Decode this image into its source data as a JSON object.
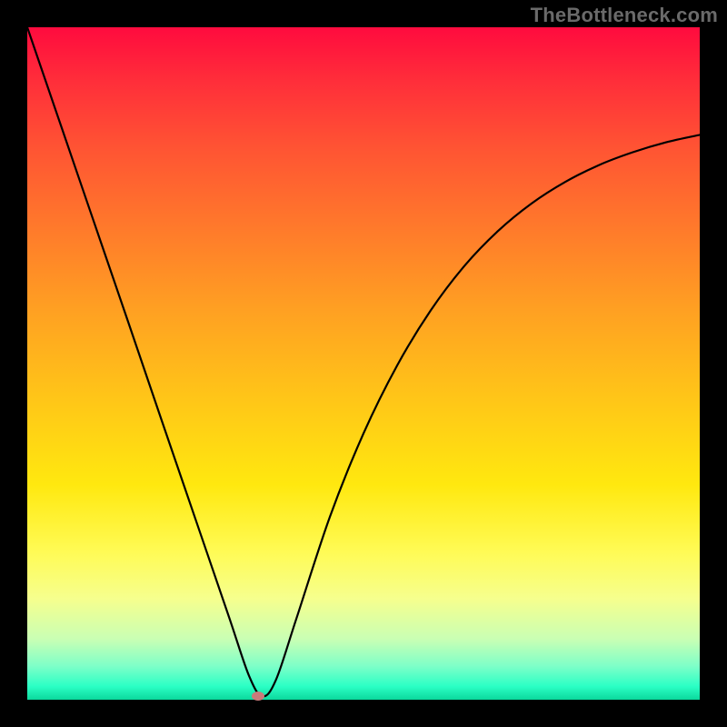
{
  "domain": "Chart",
  "watermark": "TheBottleneck.com",
  "colors": {
    "frame": "#000000",
    "gradient_top": "#ff0b3e",
    "gradient_bottom": "#0bd89c",
    "curve": "#000000",
    "marker": "#c97a7a"
  },
  "chart_data": {
    "type": "line",
    "title": "",
    "xlabel": "",
    "ylabel": "",
    "xlim": [
      0,
      100
    ],
    "ylim": [
      0,
      100
    ],
    "series": [
      {
        "name": "bottleneck-curve",
        "x": [
          0,
          5,
          10,
          15,
          20,
          25,
          30,
          33,
          35,
          37,
          40,
          45,
          50,
          55,
          60,
          65,
          70,
          75,
          80,
          85,
          90,
          95,
          100
        ],
        "values": [
          100,
          85.4,
          70.8,
          56.2,
          41.5,
          26.9,
          12.3,
          3.5,
          0.5,
          3.0,
          12.0,
          27.2,
          39.6,
          49.7,
          57.9,
          64.5,
          69.7,
          73.8,
          77.0,
          79.5,
          81.4,
          82.9,
          84.0
        ]
      }
    ],
    "annotations": [
      {
        "name": "optimal-point",
        "x": 34.3,
        "y": 0.5
      }
    ]
  }
}
